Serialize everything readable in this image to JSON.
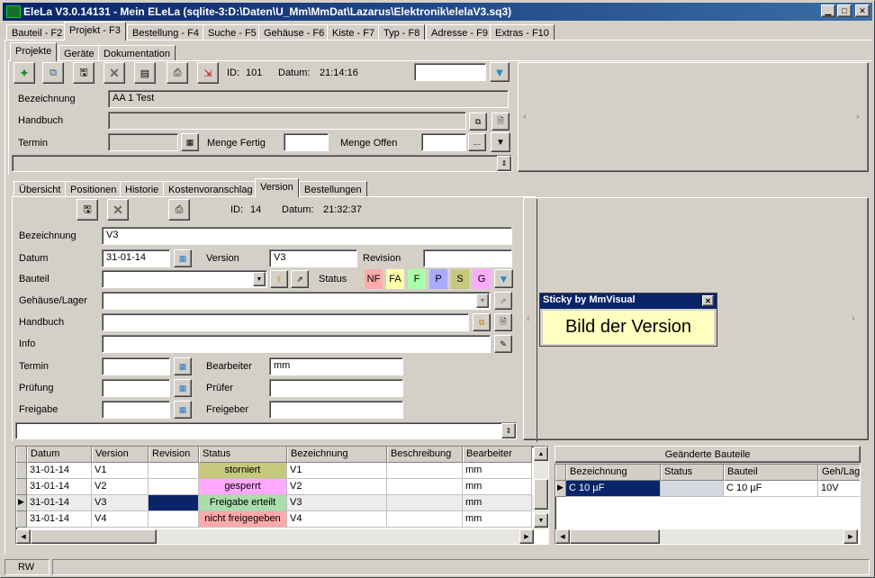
{
  "window": {
    "title": "EleLa V3.0.14131  - Mein ELeLa (sqlite-3:D:\\Daten\\U_Mm\\MmDat\\Lazarus\\Elektronik\\elelaV3.sq3)"
  },
  "main_tabs": [
    "Bauteil - F2",
    "Projekt - F3",
    "Bestellung - F4",
    "Suche - F5",
    "Gehäuse - F6",
    "Kiste - F7",
    "Typ - F8",
    "Adresse - F9",
    "Extras - F10"
  ],
  "sub_tabs": [
    "Projekte",
    "Geräte",
    "Dokumentation"
  ],
  "project": {
    "id_label": "ID:",
    "id": "101",
    "datum_label": "Datum:",
    "datum": "21:14:16",
    "bezeichnung_label": "Bezeichnung",
    "bezeichnung": "AA 1 Test",
    "handbuch_label": "Handbuch",
    "termin_label": "Termin",
    "menge_fertig_label": "Menge Fertig",
    "menge_offen_label": "Menge Offen"
  },
  "detail_tabs": [
    "Übersicht",
    "Positionen",
    "Historie",
    "Kostenvoranschlag",
    "Version",
    "Bestellungen"
  ],
  "version": {
    "id_label": "ID:",
    "id": "14",
    "datum_label": "Datum:",
    "datum": "21:32:37",
    "bezeichnung_label": "Bezeichnung",
    "bezeichnung": "V3",
    "datum_field_label": "Datum",
    "datum_field": "31-01-14",
    "version_label": "Version",
    "version": "V3",
    "revision_label": "Revision",
    "revision": "",
    "bauteil_label": "Bauteil",
    "status_label": "Status",
    "gehaeuse_label": "Gehäuse/Lager",
    "handbuch_label": "Handbuch",
    "info_label": "Info",
    "termin_label": "Termin",
    "bearbeiter_label": "Bearbeiter",
    "bearbeiter": "mm",
    "pruefung_label": "Prüfung",
    "pruefer_label": "Prüfer",
    "freigabe_label": "Freigabe",
    "freigeber_label": "Freigeber"
  },
  "status_chips": [
    {
      "label": "NF",
      "color": "#ffaaaa"
    },
    {
      "label": "FA",
      "color": "#ffffaa"
    },
    {
      "label": "F",
      "color": "#aaffaa"
    },
    {
      "label": "P",
      "color": "#aaaaff"
    },
    {
      "label": "S",
      "color": "#c8c87c"
    },
    {
      "label": "G",
      "color": "#ffaaff"
    }
  ],
  "versions_table": {
    "columns": [
      "Datum",
      "Version",
      "Revision",
      "Status",
      "Bezeichnung",
      "Beschreibung",
      "Bearbeiter"
    ],
    "rows": [
      {
        "datum": "31-01-14",
        "version": "V1",
        "revision": "",
        "status": "storniert",
        "status_color": "#c8c87c",
        "bezeichnung": "V1",
        "beschreibung": "",
        "bearbeiter": "mm"
      },
      {
        "datum": "31-01-14",
        "version": "V2",
        "revision": "",
        "status": "gesperrt",
        "status_color": "#ffaaff",
        "bezeichnung": "V2",
        "beschreibung": "",
        "bearbeiter": "mm"
      },
      {
        "datum": "31-01-14",
        "version": "V3",
        "revision": "",
        "status": "Freigabe erteilt",
        "status_color": "#aaddaa",
        "bezeichnung": "V3",
        "beschreibung": "",
        "bearbeiter": "mm"
      },
      {
        "datum": "31-01-14",
        "version": "V4",
        "revision": "",
        "status": "nicht freigegeben",
        "status_color": "#ffaaaa",
        "bezeichnung": "V4",
        "beschreibung": "",
        "bearbeiter": "mm"
      }
    ]
  },
  "changed_parts": {
    "title": "Geänderte Bauteile",
    "columns": [
      "Bezeichnung",
      "Status",
      "Bauteil",
      "Geh/Lage"
    ],
    "rows": [
      {
        "bezeichnung": "C 10 µF",
        "status": "",
        "bauteil": "C 10 µF",
        "geh": "10V"
      }
    ]
  },
  "sticky": {
    "title": "Sticky by MmVisual",
    "text": "Bild der Version"
  },
  "statusbar": {
    "left": "RW",
    "right": ""
  }
}
